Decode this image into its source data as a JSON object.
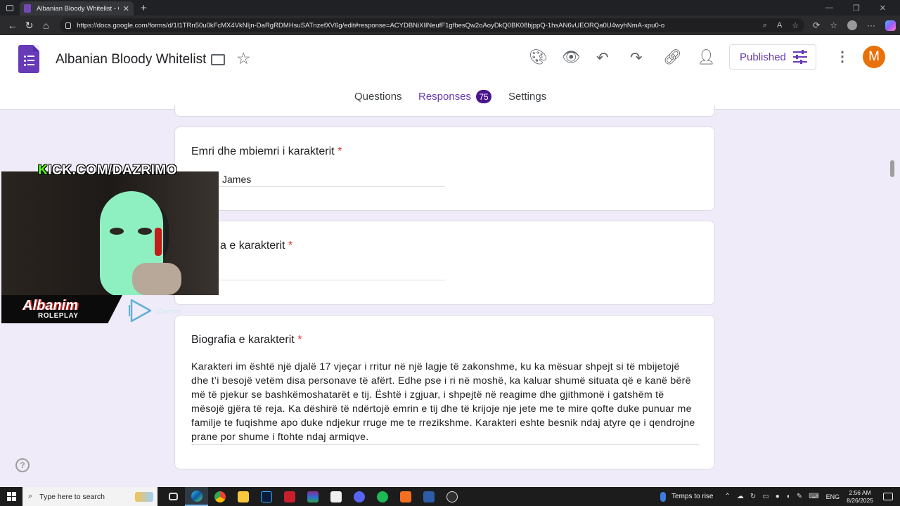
{
  "browser": {
    "tab_title": "Albanian Bloody Whitelist - Goog",
    "url": "https://docs.google.com/forms/d/1I1TRn50u0kFcMX4VkNIjn-DaRgRDMHsuSATnzefXV6g/edit#response=ACYDBNiXIlNeufF1gfbesQw2oAoyDkQ0BK08bjppQ-1hsAN6vUEORQa0U4wyhNmA-xpu0-o",
    "accent": "#673ab7"
  },
  "form": {
    "title": "Albanian Bloody Whitelist",
    "published_label": "Published",
    "avatar_initial": "M",
    "tabs": {
      "questions": "Questions",
      "responses": "Responses",
      "responses_count": "75",
      "settings": "Settings"
    },
    "questions": [
      {
        "title": "Emri dhe mbiemri i karakterit",
        "required_mark": "*",
        "answer": "James"
      },
      {
        "title": "a e karakterit",
        "required_mark": "*",
        "answer": ""
      },
      {
        "title": "Biografia e karakterit",
        "required_mark": "*",
        "answer": "Karakteri im është një djalë 17 vjeçar i rritur në një lagje të zakonshme, ku ka mësuar shpejt si të mbijetojë dhe t’i besojë vetëm disa personave të afërt. Edhe pse i ri në moshë, ka kaluar shumë situata që e kanë bërë më të pjekur se bashkëmoshatarët e tij. Është i zgjuar, i shpejtë në reagime dhe gjithmonë i gatshëm të mësojë gjëra të reja. Ka dëshirë të ndërtojë emrin e tij dhe të krijoje nje jete me te mire qofte duke punuar me familje te fuqishme apo duke ndjekur rruge me te rrezikshme. Karakteri eshte besnik ndaj atyre qe i qendrojne prane por shume i ftohte ndaj armiqve."
      }
    ]
  },
  "overlay": {
    "kick_prefix": "K",
    "kick_rest": "ICK.COM/DAZRIMO",
    "brand_name": "Albanim",
    "brand_sub": "ROLEPLAY",
    "handle": "/Dazrimo"
  },
  "taskbar": {
    "search_placeholder": "Type here to search",
    "weather": "Temps to rise",
    "lang": "ENG",
    "time": "2:56 AM",
    "date": "8/26/2025"
  }
}
